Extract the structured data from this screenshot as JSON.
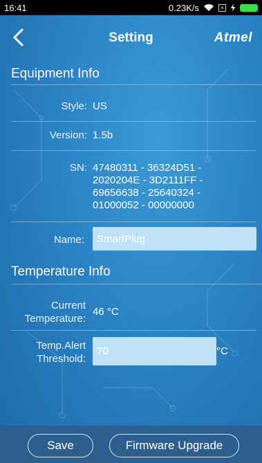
{
  "status_bar": {
    "time": "16:41",
    "network_speed": "0.23K/s"
  },
  "header": {
    "title": "Setting",
    "brand": "Atmel"
  },
  "equipment": {
    "section_title": "Equipment Info",
    "style_label": "Style:",
    "style_value": "US",
    "version_label": "Version:",
    "version_value": "1.5b",
    "sn_label": "SN:",
    "sn_lines": [
      "47480311 - 36324D51 -",
      "2020204E - 3D2111FF -",
      "69656638 - 25640324 -",
      "01000052 - 00000000"
    ],
    "name_label": "Name:",
    "name_placeholder": "SmartPlug"
  },
  "temperature": {
    "section_title": "Temperature Info",
    "current_label_1": "Current",
    "current_label_2": "Temperature:",
    "current_value": "46 °C",
    "alert_label_1": "Temp.Alert",
    "alert_label_2": "Threshold:",
    "alert_placeholder": "70",
    "alert_unit": "°C"
  },
  "footer": {
    "save_label": "Save",
    "firmware_label": "Firmware Upgrade"
  },
  "colors": {
    "background": "#2a82c4",
    "input_fill": "#bfe1f8",
    "bottom_bar": "#2c5f8e",
    "battery": "#3ddc4d"
  }
}
